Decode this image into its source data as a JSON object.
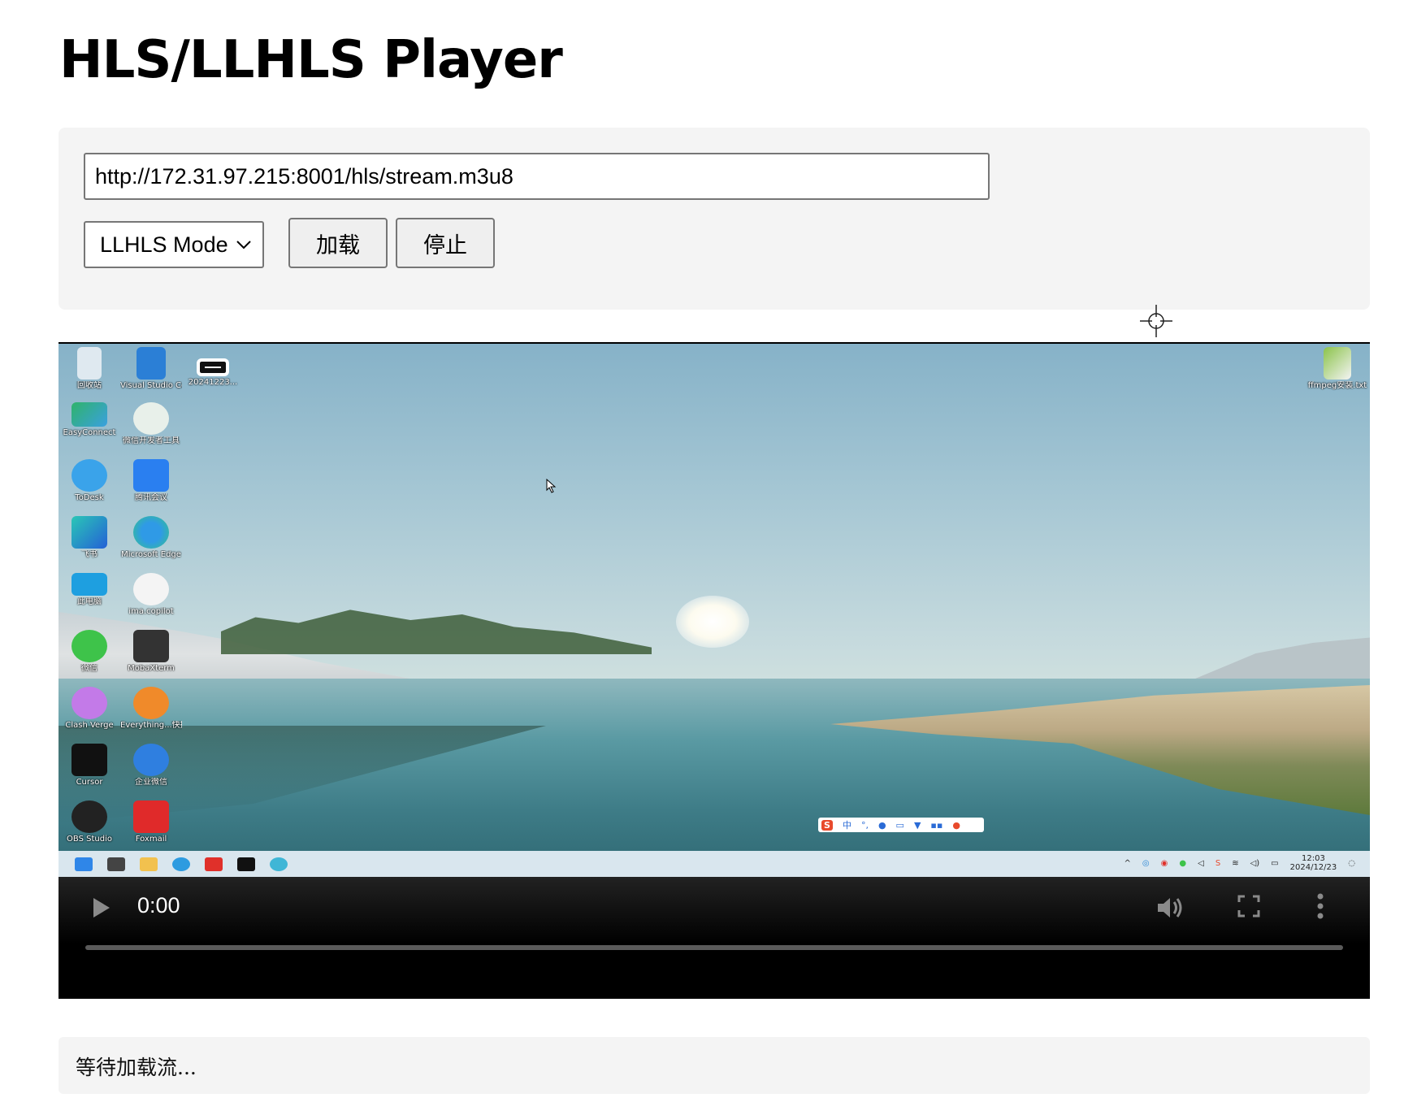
{
  "page": {
    "title": "HLS/LLHLS Player"
  },
  "controls": {
    "url_value": "http://172.31.97.215:8001/hls/stream.m3u8",
    "mode_selected": "LLHLS Mode",
    "load_label": "加载",
    "stop_label": "停止"
  },
  "video": {
    "time": "0:00",
    "progress": 0,
    "desktop_icons": [
      "回收站",
      "Visual Studio Code",
      "20241223...",
      "EasyConnect",
      "微信开发者工具",
      "ToDesk",
      "腾讯会议",
      "飞书",
      "Microsoft Edge",
      "此电脑",
      "ima.copilot",
      "微信",
      "MobaXterm",
      "Clash Verge",
      "Everything...快捷方式",
      "Cursor",
      "企业微信",
      "OBS Studio",
      "Foxmail",
      "ffmpeg安装.txt"
    ],
    "ime_label": "中",
    "clock_time": "12:03",
    "clock_date": "2024/12/23"
  },
  "status": {
    "text": "等待加载流..."
  }
}
